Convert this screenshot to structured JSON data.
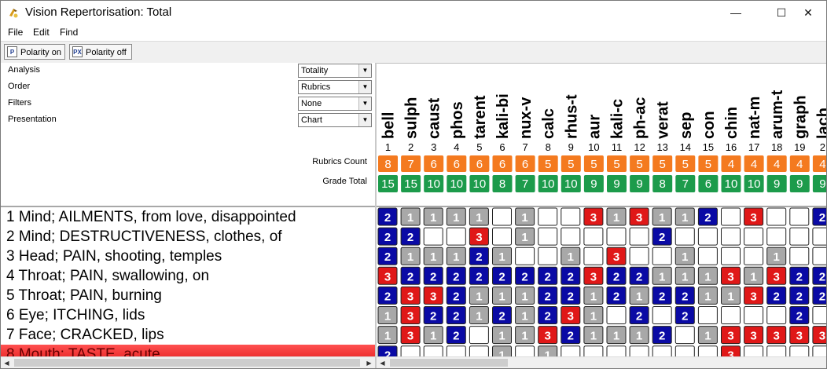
{
  "window": {
    "title": "Vision Repertorisation: Total",
    "controls": {
      "minimize": "—",
      "maximize": "☐",
      "close": "✕"
    }
  },
  "menu": [
    "File",
    "Edit",
    "Find"
  ],
  "toolbar": {
    "polarity_on": "Polarity on",
    "polarity_off": "Polarity off",
    "polarity_on_icon": "P",
    "polarity_off_icon": "PX"
  },
  "settings": [
    {
      "label": "Analysis",
      "value": "Totality"
    },
    {
      "label": "Order",
      "value": "Rubrics"
    },
    {
      "label": "Filters",
      "value": "None"
    },
    {
      "label": "Presentation",
      "value": "Chart"
    }
  ],
  "summary_labels": {
    "rubrics_count": "Rubrics Count",
    "grade_total": "Grade Total"
  },
  "colors": {
    "orange": "#f47a1f",
    "green": "#1c9b4b",
    "blue": "#0a0aa5",
    "red": "#e01818",
    "grey": "#a8a8a8",
    "selected_row": "#ff3434"
  },
  "rubrics": [
    "1 Mind; AILMENTS, from love, disappointed",
    "2 Mind; DESTRUCTIVENESS, clothes, of",
    "3 Head; PAIN, shooting, temples",
    "4 Throat; PAIN, swallowing, on",
    "5 Throat; PAIN, burning",
    "6 Eye; ITCHING, lids",
    "7 Face; CRACKED, lips",
    "8 Mouth; TASTE, acute"
  ],
  "selected_rubric": 7,
  "chart_data": {
    "type": "table",
    "remedies": [
      "bell",
      "sulph",
      "caust",
      "phos",
      "tarent",
      "kali-bi",
      "nux-v",
      "calc",
      "rhus-t",
      "aur",
      "kali-c",
      "ph-ac",
      "verat",
      "sep",
      "con",
      "chin",
      "nat-m",
      "arum-t",
      "graph",
      "lach"
    ],
    "ranks": [
      "1",
      "2",
      "3",
      "4",
      "5",
      "6",
      "7",
      "8",
      "9",
      "10",
      "11",
      "12",
      "13",
      "14",
      "15",
      "16",
      "17",
      "18",
      "19",
      "2"
    ],
    "rubrics_count": [
      "8",
      "7",
      "6",
      "6",
      "6",
      "6",
      "6",
      "5",
      "5",
      "5",
      "5",
      "5",
      "5",
      "5",
      "5",
      "4",
      "4",
      "4",
      "4",
      "4"
    ],
    "grade_total": [
      "15",
      "15",
      "10",
      "10",
      "10",
      "8",
      "7",
      "10",
      "10",
      "9",
      "9",
      "9",
      "8",
      "7",
      "6",
      "10",
      "10",
      "9",
      "9",
      "9"
    ],
    "grades": [
      [
        2,
        1,
        1,
        1,
        1,
        0,
        1,
        0,
        0,
        3,
        1,
        3,
        1,
        1,
        2,
        0,
        3,
        0,
        0,
        2
      ],
      [
        2,
        2,
        0,
        0,
        3,
        0,
        1,
        0,
        0,
        0,
        0,
        0,
        2,
        0,
        0,
        0,
        0,
        0,
        0,
        0
      ],
      [
        2,
        1,
        1,
        1,
        2,
        1,
        0,
        0,
        1,
        0,
        3,
        0,
        0,
        1,
        0,
        0,
        0,
        1,
        0,
        0
      ],
      [
        3,
        2,
        2,
        2,
        2,
        2,
        2,
        2,
        2,
        3,
        2,
        2,
        1,
        1,
        1,
        3,
        1,
        3,
        2,
        2
      ],
      [
        2,
        3,
        3,
        2,
        1,
        1,
        1,
        2,
        2,
        1,
        2,
        1,
        2,
        2,
        1,
        1,
        3,
        2,
        2,
        2
      ],
      [
        1,
        3,
        2,
        2,
        1,
        2,
        1,
        2,
        3,
        1,
        0,
        2,
        0,
        2,
        0,
        0,
        0,
        0,
        2,
        0
      ],
      [
        1,
        3,
        1,
        2,
        0,
        1,
        1,
        3,
        2,
        1,
        1,
        1,
        2,
        0,
        1,
        3,
        3,
        3,
        3,
        3
      ],
      [
        2,
        0,
        0,
        0,
        0,
        1,
        0,
        1,
        0,
        0,
        0,
        0,
        0,
        0,
        0,
        3,
        0,
        0,
        0,
        0
      ]
    ]
  }
}
